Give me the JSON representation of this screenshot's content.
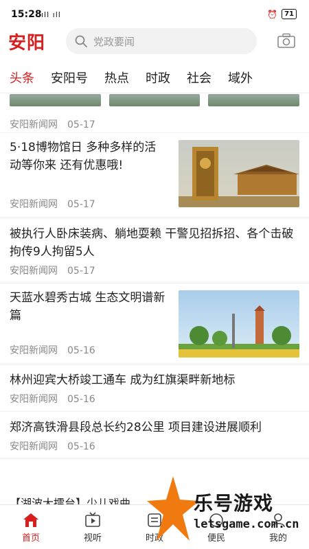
{
  "status_bar": {
    "time": "15:28",
    "signal": "ıll ıll",
    "battery": "71"
  },
  "header": {
    "logo": "安阳",
    "search_placeholder": "党政要闻"
  },
  "tabs": [
    "头条",
    "安阳号",
    "热点",
    "时政",
    "社会",
    "域外"
  ],
  "top_meta": {
    "source": "安阳新闻网",
    "date": "05-17"
  },
  "articles": [
    {
      "title": "5·18博物馆日 多种多样的活动等你来 还有优惠哦!",
      "source": "安阳新闻网",
      "date": "05-17"
    },
    {
      "title": "被执行人卧床装病、躺地耍赖 干警见招拆招、各个击破拘传9人拘留5人",
      "source": "安阳新闻网",
      "date": "05-17"
    },
    {
      "title": "天蓝水碧秀古城 生态文明谱新篇",
      "source": "安阳新闻网",
      "date": "05-16"
    },
    {
      "title": "林州迎宾大桥竣工通车 成为红旗渠畔新地标",
      "source": "安阳新闻网",
      "date": "05-16"
    },
    {
      "title": "郑济高铁滑县段总长约28公里 项目建设进展顺利",
      "source": "安阳新闻网",
      "date": "05-16"
    }
  ],
  "ticker": "【湖波大擂台】少儿戏曲",
  "bottom_nav": [
    "首页",
    "视听",
    "时政",
    "便民",
    "我的"
  ],
  "watermark": {
    "text": "乐号游戏",
    "url": "letsgame.com.cn"
  },
  "colors": {
    "accent": "#d81e1e"
  }
}
